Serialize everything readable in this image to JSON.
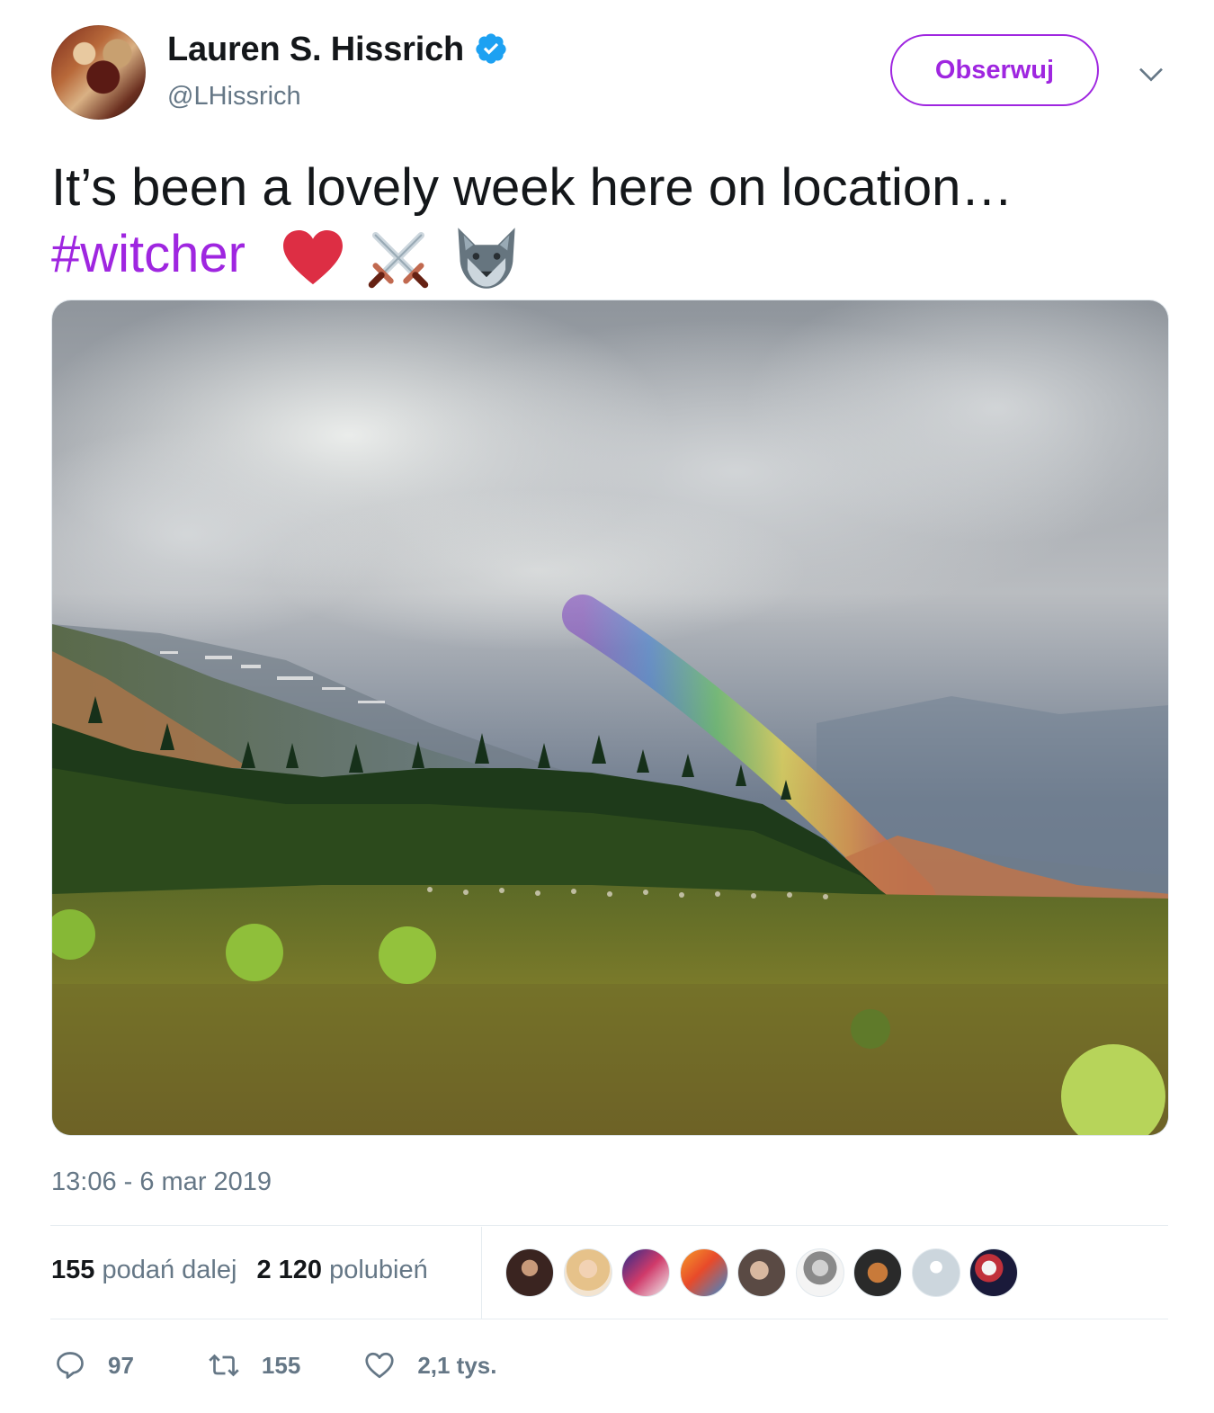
{
  "author": {
    "display_name": "Lauren S. Hissrich",
    "handle": "@LHissrich",
    "verified": true
  },
  "follow_button": {
    "label": "Obserwuj"
  },
  "tweet": {
    "text": "It’s been a lovely week here on location…",
    "hashtag": "#witcher",
    "emojis": [
      "red-heart",
      "crossed-swords",
      "wolf-face"
    ]
  },
  "timestamp": "13:06 - 6 mar 2019",
  "stats": {
    "retweets_count": "155",
    "retweets_label": "podań dalej",
    "likes_count": "2 120",
    "likes_label": "polubień"
  },
  "likers": [
    "liker-1",
    "liker-2",
    "liker-3",
    "liker-4",
    "liker-5",
    "liker-6",
    "liker-7",
    "liker-8",
    "liker-9"
  ],
  "actions": {
    "reply_count": "97",
    "retweet_count": "155",
    "like_count": "2,1 tys."
  },
  "colors": {
    "accent": "#9f26e0",
    "verified": "#1da1f2",
    "muted_text": "#657786",
    "text": "#14171a"
  }
}
